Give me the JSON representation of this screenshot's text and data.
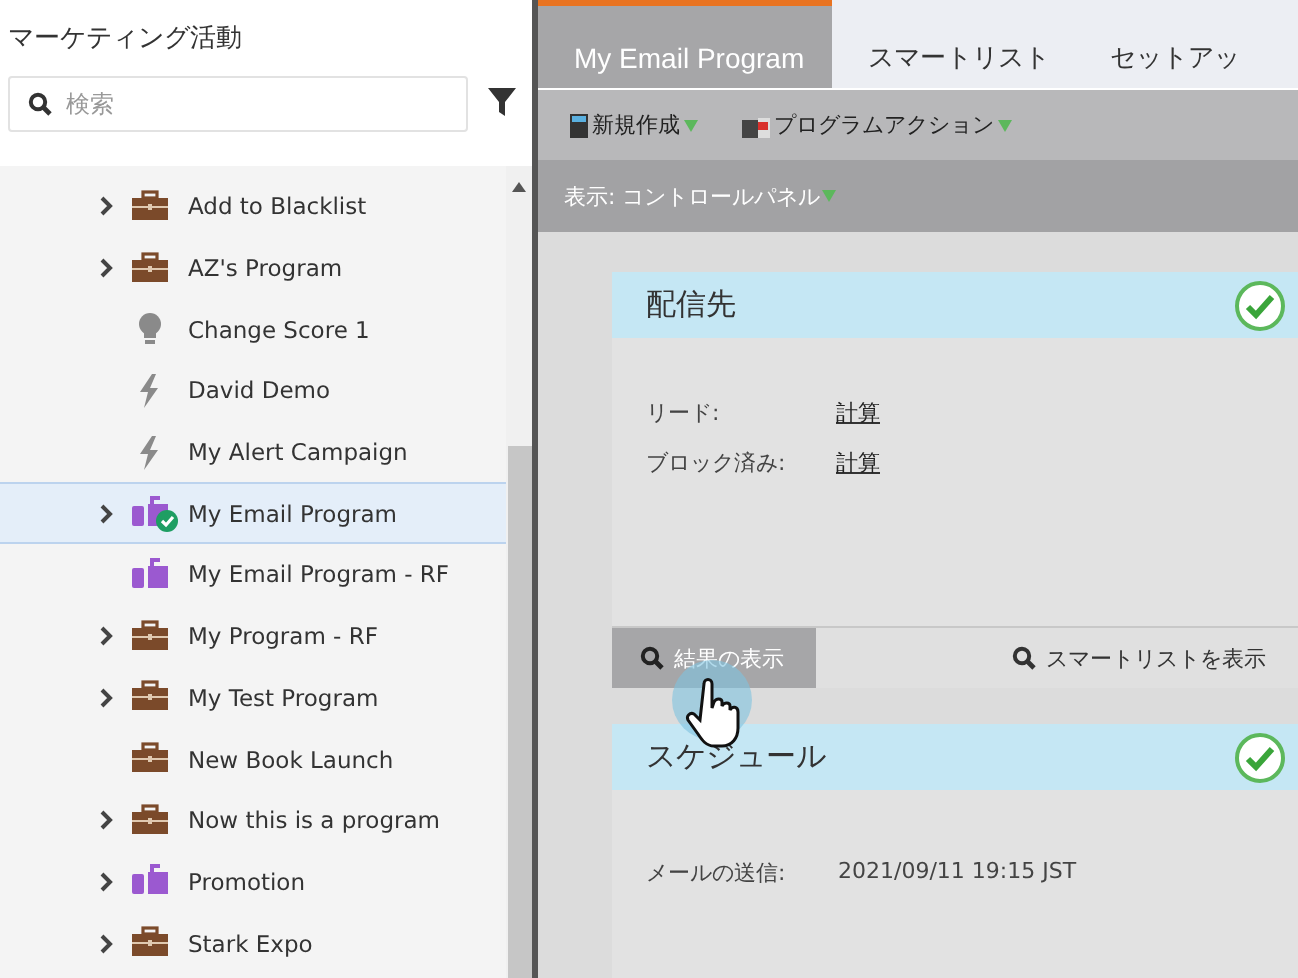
{
  "sidebar": {
    "title": "マーケティング活動",
    "search": {
      "placeholder": "検索"
    },
    "items": [
      {
        "label": "Add to Blacklist",
        "kind": "program",
        "expandable": true,
        "selected": false,
        "approved": false
      },
      {
        "label": "AZ's Program",
        "kind": "program",
        "expandable": true,
        "selected": false,
        "approved": false
      },
      {
        "label": "Change Score 1",
        "kind": "bulb",
        "expandable": false,
        "selected": false,
        "approved": false
      },
      {
        "label": "David Demo",
        "kind": "campaign",
        "expandable": false,
        "selected": false,
        "approved": false
      },
      {
        "label": "My Alert Campaign",
        "kind": "campaign",
        "expandable": false,
        "selected": false,
        "approved": false
      },
      {
        "label": "My Email Program",
        "kind": "email",
        "expandable": true,
        "selected": true,
        "approved": true
      },
      {
        "label": "My Email Program - RF",
        "kind": "email",
        "expandable": false,
        "selected": false,
        "approved": false
      },
      {
        "label": "My Program - RF",
        "kind": "program",
        "expandable": true,
        "selected": false,
        "approved": false
      },
      {
        "label": "My Test Program",
        "kind": "program",
        "expandable": true,
        "selected": false,
        "approved": false
      },
      {
        "label": "New Book Launch",
        "kind": "program",
        "expandable": false,
        "selected": false,
        "approved": false
      },
      {
        "label": "Now this is a program",
        "kind": "program",
        "expandable": true,
        "selected": false,
        "approved": false
      },
      {
        "label": "Promotion",
        "kind": "email",
        "expandable": true,
        "selected": false,
        "approved": false
      },
      {
        "label": "Stark Expo",
        "kind": "program",
        "expandable": true,
        "selected": false,
        "approved": false
      }
    ]
  },
  "tabs": [
    {
      "label": "My Email Program",
      "selected": true
    },
    {
      "label": "スマートリスト",
      "selected": false
    },
    {
      "label": "セットアッ",
      "selected": false
    }
  ],
  "toolbar": [
    {
      "label": "新規作成",
      "kind": "new"
    },
    {
      "label": "プログラムアクション",
      "kind": "action"
    }
  ],
  "view_bar": {
    "label": "表示: コントロールパネル"
  },
  "cards": [
    {
      "title": "配信先",
      "complete": true,
      "rows": [
        {
          "label": "リード:",
          "value": "計算",
          "link": true
        },
        {
          "label": "ブロック済み:",
          "value": "計算",
          "link": true
        }
      ],
      "buttons": [
        {
          "label": "結果の表示",
          "pressed": true
        },
        {
          "label": "スマートリストを表示",
          "pressed": false
        }
      ]
    },
    {
      "title": "スケジュール",
      "complete": true,
      "rows": [
        {
          "label": "メールの送信:",
          "value": "2021/09/11 19:15 JST",
          "link": false
        }
      ]
    }
  ]
}
